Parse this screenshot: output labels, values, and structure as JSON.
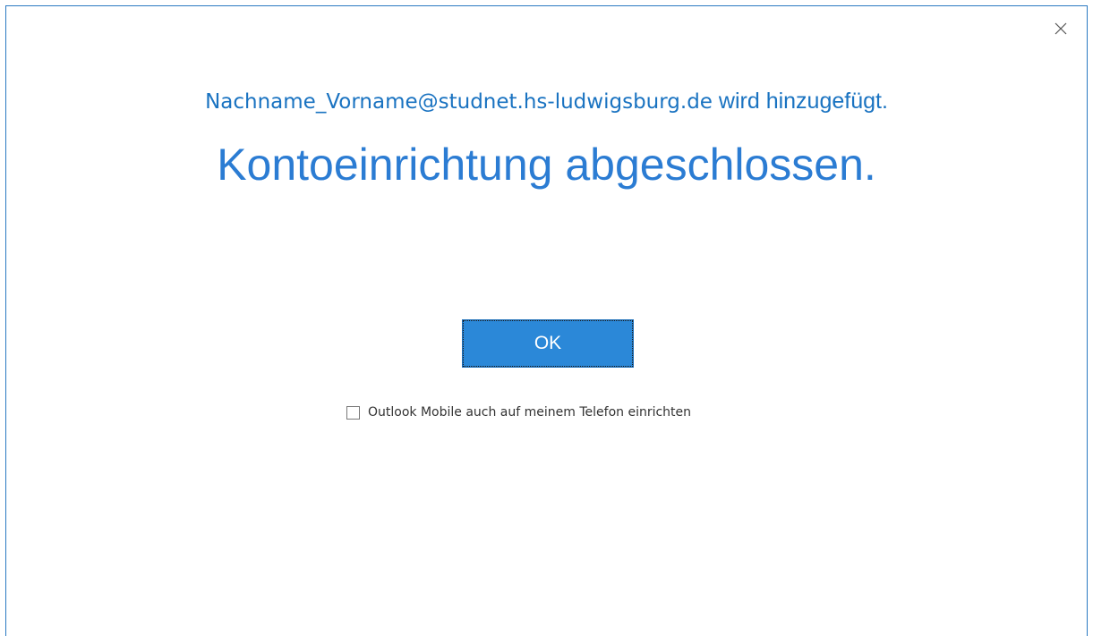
{
  "dialog": {
    "close_icon": "close-icon",
    "account_email": "Nachname_Vorname@studnet.hs-ludwigsburg.de",
    "adding_suffix": " wird hinzugefügt.",
    "title": "Kontoeinrichtung abgeschlossen.",
    "ok_label": "OK",
    "mobile_checkbox_label": "Outlook Mobile auch auf meinem Telefon einrichten",
    "mobile_checkbox_checked": false
  },
  "colors": {
    "accent": "#2b88d8",
    "text_blue": "#1a73c1",
    "border": "#2b79c2"
  }
}
